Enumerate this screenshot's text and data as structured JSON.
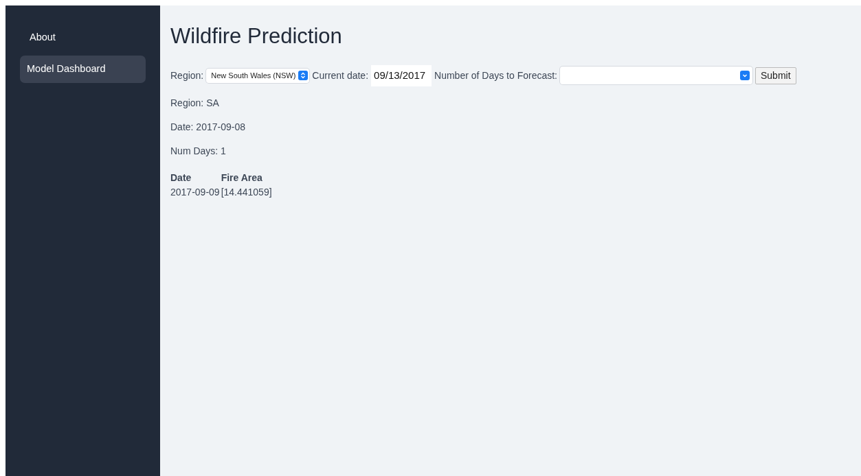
{
  "sidebar": {
    "items": [
      {
        "label": "About",
        "selected": false
      },
      {
        "label": "Model Dashboard",
        "selected": true
      }
    ]
  },
  "title": "Wildfire Prediction",
  "form": {
    "region_label": "Region:",
    "region_value": "New South Wales (NSW)",
    "date_label": "Current date:",
    "date_value": "09/13/2017",
    "days_label": "Number of Days to Forecast:",
    "submit": "Submit"
  },
  "results": [
    "Region: SA",
    "Date: 2017-09-08",
    "Num Days: 1"
  ],
  "table": {
    "columns": [
      "Date",
      "Fire Area"
    ],
    "rows": [
      [
        "2017-09-09",
        "[14.441059]"
      ]
    ]
  }
}
